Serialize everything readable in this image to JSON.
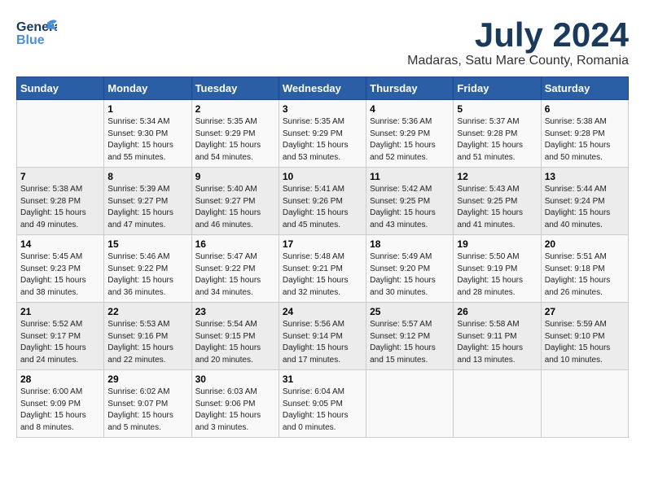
{
  "logo": {
    "line1": "General",
    "line2": "Blue"
  },
  "title": "July 2024",
  "subtitle": "Madaras, Satu Mare County, Romania",
  "days_header": [
    "Sunday",
    "Monday",
    "Tuesday",
    "Wednesday",
    "Thursday",
    "Friday",
    "Saturday"
  ],
  "weeks": [
    [
      {
        "day": "",
        "info": ""
      },
      {
        "day": "1",
        "info": "Sunrise: 5:34 AM\nSunset: 9:30 PM\nDaylight: 15 hours\nand 55 minutes."
      },
      {
        "day": "2",
        "info": "Sunrise: 5:35 AM\nSunset: 9:29 PM\nDaylight: 15 hours\nand 54 minutes."
      },
      {
        "day": "3",
        "info": "Sunrise: 5:35 AM\nSunset: 9:29 PM\nDaylight: 15 hours\nand 53 minutes."
      },
      {
        "day": "4",
        "info": "Sunrise: 5:36 AM\nSunset: 9:29 PM\nDaylight: 15 hours\nand 52 minutes."
      },
      {
        "day": "5",
        "info": "Sunrise: 5:37 AM\nSunset: 9:28 PM\nDaylight: 15 hours\nand 51 minutes."
      },
      {
        "day": "6",
        "info": "Sunrise: 5:38 AM\nSunset: 9:28 PM\nDaylight: 15 hours\nand 50 minutes."
      }
    ],
    [
      {
        "day": "7",
        "info": "Sunrise: 5:38 AM\nSunset: 9:28 PM\nDaylight: 15 hours\nand 49 minutes."
      },
      {
        "day": "8",
        "info": "Sunrise: 5:39 AM\nSunset: 9:27 PM\nDaylight: 15 hours\nand 47 minutes."
      },
      {
        "day": "9",
        "info": "Sunrise: 5:40 AM\nSunset: 9:27 PM\nDaylight: 15 hours\nand 46 minutes."
      },
      {
        "day": "10",
        "info": "Sunrise: 5:41 AM\nSunset: 9:26 PM\nDaylight: 15 hours\nand 45 minutes."
      },
      {
        "day": "11",
        "info": "Sunrise: 5:42 AM\nSunset: 9:25 PM\nDaylight: 15 hours\nand 43 minutes."
      },
      {
        "day": "12",
        "info": "Sunrise: 5:43 AM\nSunset: 9:25 PM\nDaylight: 15 hours\nand 41 minutes."
      },
      {
        "day": "13",
        "info": "Sunrise: 5:44 AM\nSunset: 9:24 PM\nDaylight: 15 hours\nand 40 minutes."
      }
    ],
    [
      {
        "day": "14",
        "info": "Sunrise: 5:45 AM\nSunset: 9:23 PM\nDaylight: 15 hours\nand 38 minutes."
      },
      {
        "day": "15",
        "info": "Sunrise: 5:46 AM\nSunset: 9:22 PM\nDaylight: 15 hours\nand 36 minutes."
      },
      {
        "day": "16",
        "info": "Sunrise: 5:47 AM\nSunset: 9:22 PM\nDaylight: 15 hours\nand 34 minutes."
      },
      {
        "day": "17",
        "info": "Sunrise: 5:48 AM\nSunset: 9:21 PM\nDaylight: 15 hours\nand 32 minutes."
      },
      {
        "day": "18",
        "info": "Sunrise: 5:49 AM\nSunset: 9:20 PM\nDaylight: 15 hours\nand 30 minutes."
      },
      {
        "day": "19",
        "info": "Sunrise: 5:50 AM\nSunset: 9:19 PM\nDaylight: 15 hours\nand 28 minutes."
      },
      {
        "day": "20",
        "info": "Sunrise: 5:51 AM\nSunset: 9:18 PM\nDaylight: 15 hours\nand 26 minutes."
      }
    ],
    [
      {
        "day": "21",
        "info": "Sunrise: 5:52 AM\nSunset: 9:17 PM\nDaylight: 15 hours\nand 24 minutes."
      },
      {
        "day": "22",
        "info": "Sunrise: 5:53 AM\nSunset: 9:16 PM\nDaylight: 15 hours\nand 22 minutes."
      },
      {
        "day": "23",
        "info": "Sunrise: 5:54 AM\nSunset: 9:15 PM\nDaylight: 15 hours\nand 20 minutes."
      },
      {
        "day": "24",
        "info": "Sunrise: 5:56 AM\nSunset: 9:14 PM\nDaylight: 15 hours\nand 17 minutes."
      },
      {
        "day": "25",
        "info": "Sunrise: 5:57 AM\nSunset: 9:12 PM\nDaylight: 15 hours\nand 15 minutes."
      },
      {
        "day": "26",
        "info": "Sunrise: 5:58 AM\nSunset: 9:11 PM\nDaylight: 15 hours\nand 13 minutes."
      },
      {
        "day": "27",
        "info": "Sunrise: 5:59 AM\nSunset: 9:10 PM\nDaylight: 15 hours\nand 10 minutes."
      }
    ],
    [
      {
        "day": "28",
        "info": "Sunrise: 6:00 AM\nSunset: 9:09 PM\nDaylight: 15 hours\nand 8 minutes."
      },
      {
        "day": "29",
        "info": "Sunrise: 6:02 AM\nSunset: 9:07 PM\nDaylight: 15 hours\nand 5 minutes."
      },
      {
        "day": "30",
        "info": "Sunrise: 6:03 AM\nSunset: 9:06 PM\nDaylight: 15 hours\nand 3 minutes."
      },
      {
        "day": "31",
        "info": "Sunrise: 6:04 AM\nSunset: 9:05 PM\nDaylight: 15 hours\nand 0 minutes."
      },
      {
        "day": "",
        "info": ""
      },
      {
        "day": "",
        "info": ""
      },
      {
        "day": "",
        "info": ""
      }
    ]
  ]
}
